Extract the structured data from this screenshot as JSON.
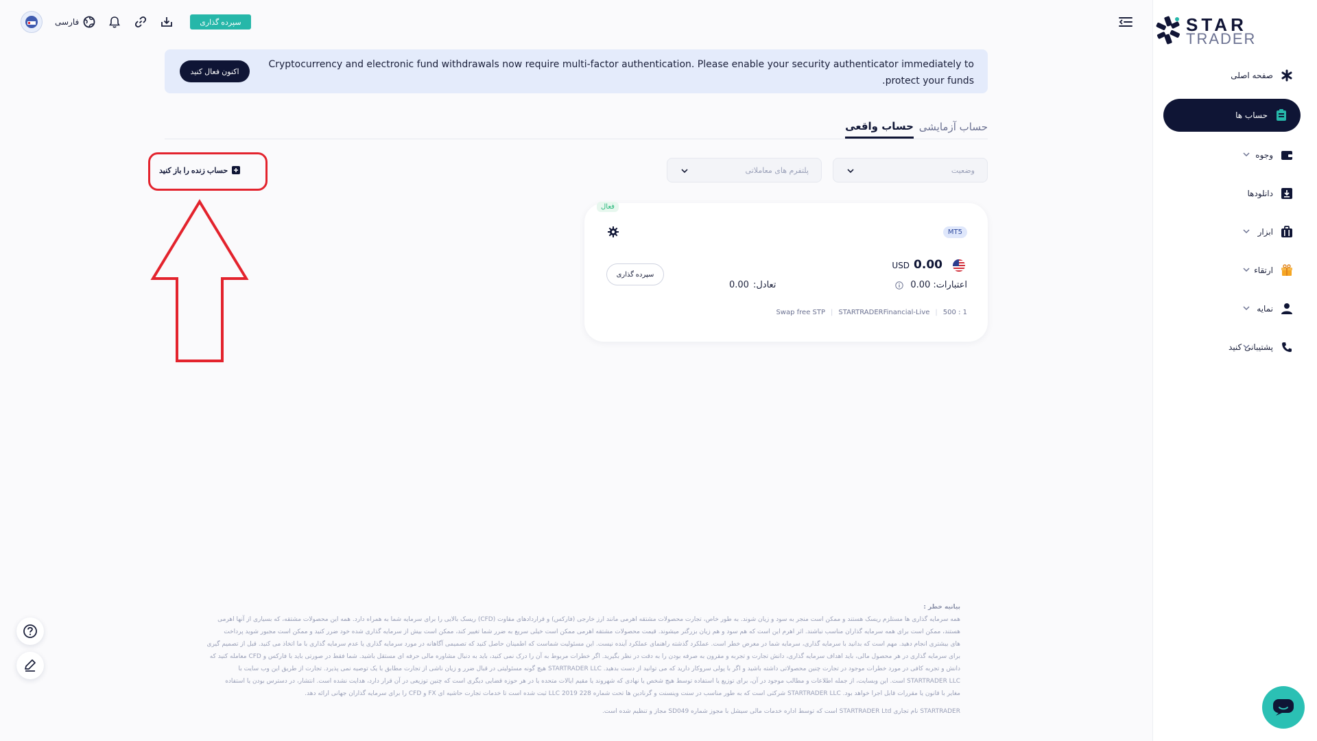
{
  "brand": {
    "word1": "STAR",
    "word2": "TRADER"
  },
  "sidebar": {
    "items": [
      {
        "label": "صفحه اصلی",
        "icon": "asterisk-icon",
        "active": false,
        "expandable": false
      },
      {
        "label": "حساب ها",
        "icon": "clipboard-icon",
        "active": true,
        "expandable": false
      },
      {
        "label": "وجوه",
        "icon": "wallet-icon",
        "active": false,
        "expandable": true
      },
      {
        "label": "دانلودها",
        "icon": "download-icon",
        "active": false,
        "expandable": false
      },
      {
        "label": "ابزار",
        "icon": "briefcase-icon",
        "active": false,
        "expandable": true
      },
      {
        "label": "ارتقاء",
        "icon": "gift-icon",
        "active": false,
        "expandable": true
      },
      {
        "label": "نمایه",
        "icon": "user-icon",
        "active": false,
        "expandable": true
      },
      {
        "label": "پشتیبانی کنید",
        "icon": "phone-icon",
        "active": false,
        "expandable": true
      }
    ]
  },
  "topbar": {
    "deposit_label": "سپرده گذاری",
    "language_label": "فارسی"
  },
  "banner": {
    "text": "Cryptocurrency and electronic fund withdrawals now require multi-factor authentication. Please enable your security authenticator immediately to protect your funds.",
    "button_label": "اکنون فعال کنید"
  },
  "tabs": {
    "demo": "حساب آزمایشی",
    "real": "حساب واقعی"
  },
  "filters": {
    "status_placeholder": "وضعیت",
    "platform_placeholder": "پلتفرم های معاملاتی"
  },
  "open_live_label": "حساب زنده را باز کنید",
  "account": {
    "status": "فعال",
    "platform": "MT5",
    "balance": "0.00",
    "currency": "USD",
    "credit_label": "اعتبارات:",
    "credit_value": "0.00",
    "equity_label": "تعادل:",
    "equity_value": "0.00",
    "deposit_label": "سپرده گذاری",
    "leverage": "1 : 500",
    "account_type": "STARTRADERFinancial-Live",
    "account_kind": "Swap free STP"
  },
  "disclaimer": {
    "title": "بیانیه خطر :",
    "lines": [
      "همه سرمایه گذاری ها مستلزم ریسک هستند و ممکن است منجر به سود و زیان شوند. به طور خاص، تجارت محصولات مشتقه اهرمی مانند ارز خارجی (فارکس) و قراردادهای مقاوت (CFD) ریسک بالایی را برای سرمایه شما به همراه دارد. همه این محصولات مشتقه، که بسیاری از آنها اهرمی",
      "هستند، ممکن است برای همه سرمایه گذاران مناسب نباشند. اثر اهرم این است که هم سود و هم زیان بزرگنر میشوند. قیمت محصولات مشتقه اهرمی ممکن است خیلی سریع به ضرر شما تغییر کند، ممکن است بیش از سرمایه گذاری شده خود ضرر کنید و ممکن است مجبور شوید پرداخت",
      "های بیشتری انجام دهید. مهم است که بدانید با سرمایه گذاری، سرمایه شما در معرض خطر است. عملکرد گذشته راهنمای عملکرد آینده نیست. این مسئولیت شماست که اطمینان حاصل کنید که تصمیمی آگاهانه در مورد سرمایه گذاری یا عدم سرمایه گذاری با ما اتخاذ می کنید. قبل از تصمیم گیری",
      "برای سرمایه گذاری در هر محصول مالی، باید اهداف سرمایه گذاری، دانش تجارت و تجربه و مقرون به صرفه بودن را به دقت در نظر بگیرید. اگر خطرات مربوط به آن را درک نمی کنید، باید به دنبال مشاوره مالی حرفه ای مستقل باشید. شما فقط در صورتی باید با فارکس و CFD معامله کنید که",
      "دانش و تجربه کافی در مورد خطرات موجود در تجارت چنین محصولاتی داشته باشید و اگر با پولی سروکار دارید که می توانید از دست بدهید. STARTRADER LLC هیچ گونه مسئولیتی در قبال ضرر و زیان ناشی از تجارت مطابق با یک توصیه نمی پذیرد. تجارت از طریق این وب سایت با",
      "STARTRADER LLC است. این وبسایت، از جمله اطلاعات و مطالب موجود در آن، برای توزیع یا استفاده توسط هیچ شخص یا نهادی که شهروند یا مقیم ایالات متحده یا در هر حوزه قضایی دیگری است که چنین توزیعی در آن قرار دارد، هدایت نشده است. انتشار، در دسترس بودن یا استفاده",
      "مغایر با قانون یا مقررات قابل اجرا خواهد بود. STARTRADER LLC شرکتی است که به طور مناسب در سنت وینسنت و گرنادین ها تحت شماره LLC 2019 228 ثبت شده است تا خدمات تجارت حاشیه ای FX و CFD را برای سرمایه گذاران جهانی ارائه دهد."
    ],
    "footer": "STARTRADER نام تجاری STARTRADER Ltd است که توسط اداره خدمات مالی سیشل با مجوز شماره SD049 مجاز و تنظیم شده است."
  },
  "colors": {
    "accent": "#0f1535",
    "teal": "#26b7a9",
    "highlight": "#e3232d"
  }
}
